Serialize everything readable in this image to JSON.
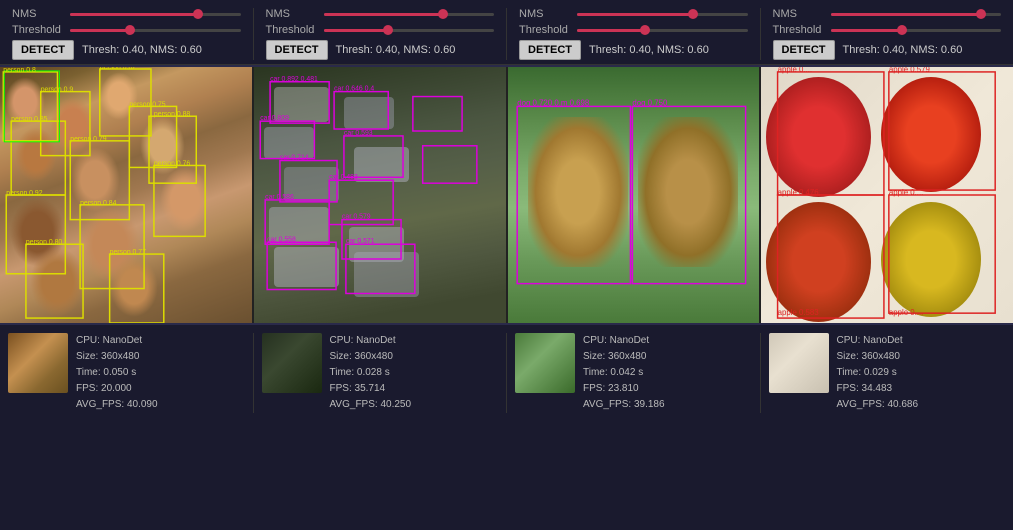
{
  "panels": [
    {
      "id": "panel1",
      "nms_label": "NMS",
      "threshold_label": "Threshold",
      "nms_fill_pct": 75,
      "nms_thumb_pct": 75,
      "threshold_fill_pct": 35,
      "threshold_thumb_pct": 35,
      "detect_label": "DETECT",
      "thresh_info": "Thresh: 0.40, NMS: 0.60"
    },
    {
      "id": "panel2",
      "nms_label": "NMS",
      "threshold_label": "Threshold",
      "nms_fill_pct": 70,
      "nms_thumb_pct": 70,
      "threshold_fill_pct": 38,
      "threshold_thumb_pct": 38,
      "detect_label": "DETECT",
      "thresh_info": "Thresh: 0.40, NMS: 0.60"
    },
    {
      "id": "panel3",
      "nms_label": "NMS",
      "threshold_label": "Threshold",
      "nms_fill_pct": 68,
      "nms_thumb_pct": 68,
      "threshold_fill_pct": 40,
      "threshold_thumb_pct": 40,
      "detect_label": "DETECT",
      "thresh_info": "Thresh: 0.40, NMS: 0.60"
    },
    {
      "id": "panel4",
      "nms_label": "NMS",
      "threshold_label": "Threshold",
      "nms_fill_pct": 88,
      "nms_thumb_pct": 88,
      "threshold_fill_pct": 42,
      "threshold_thumb_pct": 42,
      "detect_label": "DETECT",
      "thresh_info": "Thresh: 0.40, NMS: 0.60"
    }
  ],
  "thumbnails": [
    {
      "cpu": "CPU: NanoDet",
      "size": "Size: 360x480",
      "time": "Time: 0.050 s",
      "fps": "FPS: 20.000",
      "avg_fps": "AVG_FPS: 40.090"
    },
    {
      "cpu": "CPU: NanoDet",
      "size": "Size: 360x480",
      "time": "Time: 0.028 s",
      "fps": "FPS: 35.714",
      "avg_fps": "AVG_FPS: 40.250"
    },
    {
      "cpu": "CPU: NanoDet",
      "size": "Size: 360x480",
      "time": "Time: 0.042 s",
      "fps": "FPS: 23.810",
      "avg_fps": "AVG_FPS: 39.186"
    },
    {
      "cpu": "CPU: NanoDet",
      "size": "Size: 360x480",
      "time": "Time: 0.029 s",
      "fps": "FPS: 34.483",
      "avg_fps": "AVG_FPS: 40.686"
    }
  ],
  "colors": {
    "accent": "#cc3355",
    "detect_bg": "#cccccc",
    "yellow_box": "#dddd00",
    "magenta_box": "#dd00dd",
    "cyan_box": "#00dddd",
    "red_box": "#dd2222"
  }
}
